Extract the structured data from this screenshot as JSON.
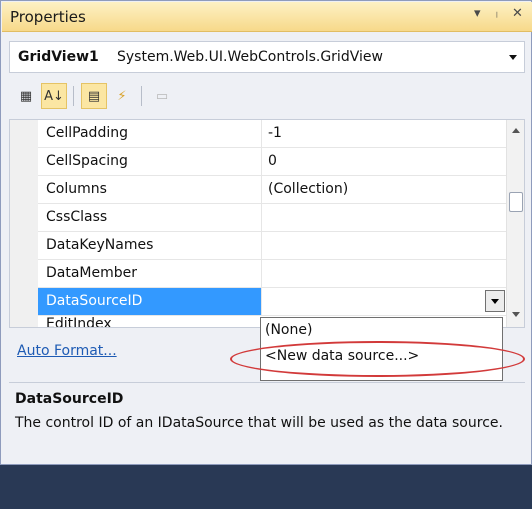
{
  "titlebar": {
    "title": "Properties",
    "controls": [
      "▾",
      "ᛧ",
      "✕"
    ]
  },
  "object_selector": {
    "name": "GridView1",
    "type": "System.Web.UI.WebControls.GridView"
  },
  "toolbar": {
    "buttons": [
      {
        "icon": "categorized-icon",
        "glyph": "▦"
      },
      {
        "icon": "alphabetical-icon",
        "glyph": "A↓"
      },
      {
        "icon": "properties-icon",
        "glyph": "▤"
      },
      {
        "icon": "events-icon",
        "glyph": "⚡"
      },
      {
        "icon": "property-pages-icon",
        "glyph": "▭"
      }
    ]
  },
  "grid": {
    "rows": [
      {
        "name": "CellPadding",
        "value": "-1"
      },
      {
        "name": "CellSpacing",
        "value": "0"
      },
      {
        "name": "Columns",
        "value": "(Collection)"
      },
      {
        "name": "CssClass",
        "value": ""
      },
      {
        "name": "DataKeyNames",
        "value": ""
      },
      {
        "name": "DataMember",
        "value": ""
      },
      {
        "name": "DataSourceID",
        "value": ""
      }
    ],
    "clipped_row": "EditIndex"
  },
  "dropdown": {
    "options": [
      "(None)",
      "<New data source...>"
    ]
  },
  "commands": {
    "link": "Auto Format..."
  },
  "description": {
    "title": "DataSourceID",
    "text": "The control ID of an IDataSource that will be used as the data source."
  },
  "colors": {
    "selected": "#3399ff",
    "annotation": "#d23a3a",
    "link": "#1e5bb4"
  }
}
